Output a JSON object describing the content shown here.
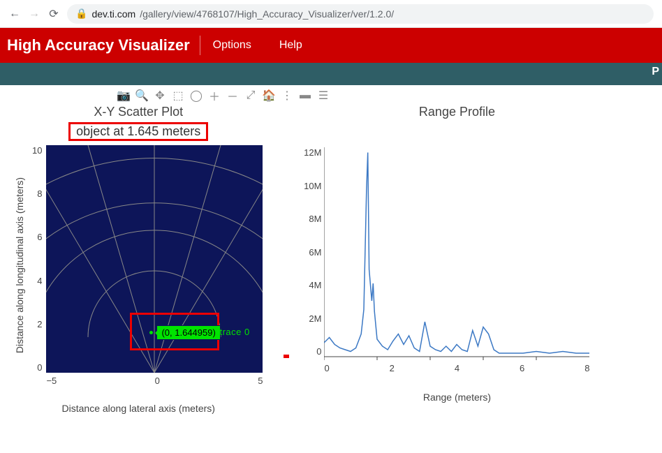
{
  "browser": {
    "url_host": "dev.ti.com",
    "url_path": "/gallery/view/4768107/High_Accuracy_Visualizer/ver/1.2.0/"
  },
  "appbar": {
    "title": "High Accuracy Visualizer",
    "options": "Options",
    "help": "Help"
  },
  "subbar": {
    "right": "P"
  },
  "scatter": {
    "title": "X-Y Scatter Plot",
    "annotation": "object at 1.645 meters",
    "ylabel": "Distance along longitudinal axis (meters)",
    "xlabel": "Distance along lateral axis (meters)",
    "yticks": [
      "10",
      "8",
      "6",
      "4",
      "2",
      "0"
    ],
    "xticks": [
      "−5",
      "0",
      "5"
    ],
    "tooltip": "(0, 1.644959)",
    "trace": "trace 0"
  },
  "range": {
    "title": "Range Profile",
    "xlabel": "Range (meters)",
    "yticks": [
      "12M",
      "10M",
      "8M",
      "6M",
      "4M",
      "2M",
      "0"
    ],
    "xticks": [
      "0",
      "2",
      "4",
      "6",
      "8"
    ]
  },
  "chart_data": [
    {
      "type": "scatter",
      "title": "X-Y Scatter Plot",
      "subtitle": "object at 1.645 meters",
      "xlabel": "Distance along lateral axis (meters)",
      "ylabel": "Distance along longitudinal axis (meters)",
      "xlim": [
        -5,
        5
      ],
      "ylim": [
        0,
        10
      ],
      "series": [
        {
          "name": "trace 0",
          "points": [
            [
              0,
              1.644959
            ]
          ]
        }
      ],
      "annotations": [
        "object at 1.645 meters"
      ],
      "radar_arcs": [
        2,
        4,
        6,
        8,
        10
      ],
      "radar_rays_deg": [
        -60,
        -30,
        0,
        30,
        60
      ]
    },
    {
      "type": "line",
      "title": "Range Profile",
      "xlabel": "Range (meters)",
      "ylabel": "",
      "xlim": [
        0,
        10
      ],
      "ylim": [
        0,
        12000000
      ],
      "series": [
        {
          "name": "profile",
          "x": [
            0,
            0.2,
            0.4,
            0.6,
            0.8,
            1.0,
            1.2,
            1.4,
            1.5,
            1.6,
            1.65,
            1.7,
            1.8,
            1.85,
            1.9,
            2.0,
            2.2,
            2.4,
            2.6,
            2.8,
            3.0,
            3.2,
            3.4,
            3.6,
            3.8,
            4.0,
            4.2,
            4.4,
            4.6,
            4.8,
            5.0,
            5.2,
            5.4,
            5.6,
            5.8,
            6.0,
            6.2,
            6.4,
            6.6,
            6.8,
            7.0,
            7.5,
            8.0,
            8.5,
            9.0,
            9.5,
            10.0
          ],
          "y": [
            800000,
            1100000,
            700000,
            500000,
            400000,
            300000,
            500000,
            1300000,
            2700000,
            9500000,
            11700000,
            5000000,
            3200000,
            4200000,
            2600000,
            1000000,
            600000,
            400000,
            900000,
            1300000,
            700000,
            1200000,
            500000,
            300000,
            2000000,
            600000,
            400000,
            300000,
            600000,
            300000,
            700000,
            400000,
            300000,
            1500000,
            600000,
            1700000,
            1300000,
            400000,
            200000,
            200000,
            200000,
            200000,
            300000,
            200000,
            300000,
            200000,
            200000
          ]
        }
      ]
    }
  ]
}
